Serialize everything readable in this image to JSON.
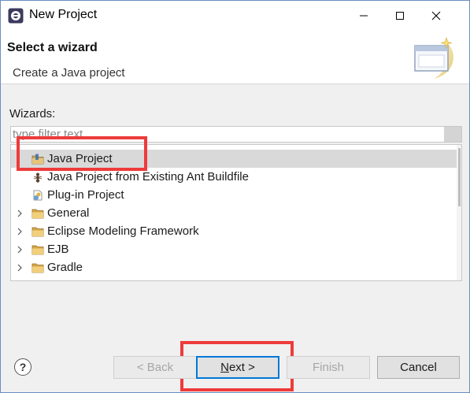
{
  "window": {
    "title": "New Project",
    "controls": {
      "minimize": "—",
      "maximize": "☐",
      "close": "✕"
    }
  },
  "banner": {
    "title": "Select a wizard",
    "description": "Create a Java project",
    "image_icon": "wizard-banner-icon"
  },
  "wizards": {
    "label": "Wizards:",
    "filter_placeholder": "type filter text",
    "items": [
      {
        "label": "Java Project",
        "icon": "java-project-folder-icon",
        "expandable": false,
        "selected": true
      },
      {
        "label": "Java Project from Existing Ant Buildfile",
        "icon": "ant-icon",
        "expandable": false,
        "selected": false
      },
      {
        "label": "Plug-in Project",
        "icon": "plugin-project-icon",
        "expandable": false,
        "selected": false
      },
      {
        "label": "General",
        "icon": "folder-icon",
        "expandable": true,
        "selected": false
      },
      {
        "label": "Eclipse Modeling Framework",
        "icon": "folder-icon",
        "expandable": true,
        "selected": false
      },
      {
        "label": "EJB",
        "icon": "folder-icon",
        "expandable": true,
        "selected": false
      },
      {
        "label": "Gradle",
        "icon": "folder-icon",
        "expandable": true,
        "selected": false
      }
    ]
  },
  "buttons": {
    "help": "?",
    "back": "< Back",
    "next_mnemonic": "N",
    "next_rest": "ext >",
    "finish": "Finish",
    "cancel": "Cancel"
  },
  "colors": {
    "highlight": "#ee3b3b",
    "selection": "#d9d9d9",
    "default_button_border": "#0078d7"
  }
}
